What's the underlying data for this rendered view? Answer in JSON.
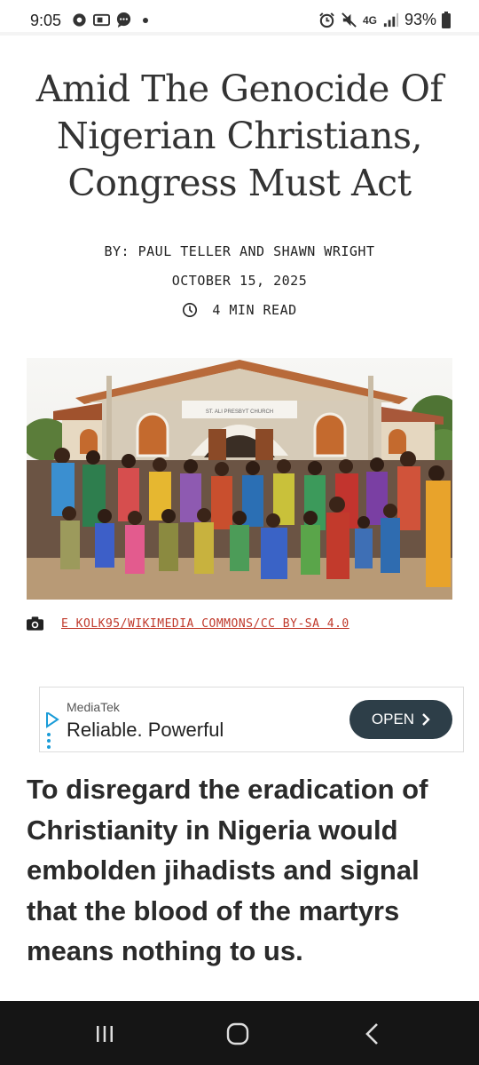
{
  "status": {
    "time": "9:05",
    "battery": "93%",
    "network": "4G",
    "icons_left": [
      "sync-icon",
      "screen-cast-icon",
      "chat-icon",
      "notification-dot"
    ],
    "icons_right": [
      "alarm-icon",
      "mute-icon",
      "lte-icon",
      "signal-icon",
      "battery-icon"
    ]
  },
  "article": {
    "headline": "Amid The Genocide Of Nigerian Christians, Congress Must Act",
    "byline": "BY: PAUL TELLER AND SHAWN WRIGHT",
    "date": "OCTOBER 15, 2025",
    "read_time": "4 MIN READ",
    "image_credit": "E KOLK95/WIKIMEDIA COMMONS/CC BY-SA 4.0",
    "image_church_sign": "ST. ALI   PRESBYT   CHURCH",
    "deck": "To disregard the eradication of Christianity in Nigeria would embolden jihadists and signal that the blood of the martyrs means nothing to us."
  },
  "ad": {
    "brand": "MediaTek",
    "tagline": "Reliable. Powerful",
    "cta": "OPEN"
  },
  "nav": {
    "buttons": [
      "recents-icon",
      "home-icon",
      "back-icon"
    ]
  },
  "colors": {
    "credit_link": "#c0392b",
    "ad_button": "#2d3e48",
    "nav_bar": "#151515"
  }
}
